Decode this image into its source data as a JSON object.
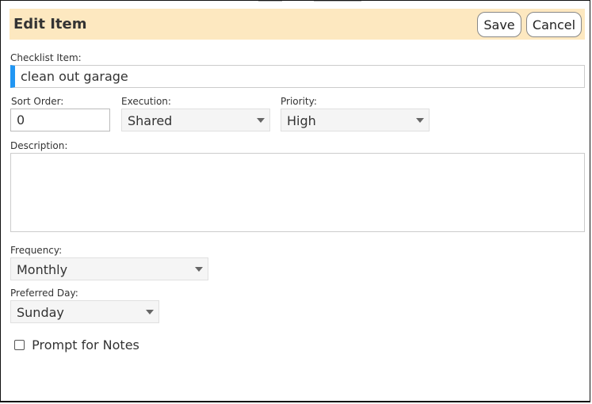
{
  "colors": {
    "header_bg": "#fde8c0",
    "accent": "#2196f3",
    "border": "#111111"
  },
  "header": {
    "title": "Edit Item",
    "save_label": "Save",
    "cancel_label": "Cancel"
  },
  "form": {
    "checklist_item": {
      "label": "Checklist Item:",
      "value": "clean out garage"
    },
    "sort_order": {
      "label": "Sort Order:",
      "value": "0"
    },
    "execution": {
      "label": "Execution:",
      "selected": "Shared",
      "icon": "chevron-down-icon"
    },
    "priority": {
      "label": "Priority:",
      "selected": "High",
      "icon": "chevron-down-icon"
    },
    "description": {
      "label": "Description:",
      "value": ""
    },
    "frequency": {
      "label": "Frequency:",
      "selected": "Monthly",
      "icon": "chevron-down-icon"
    },
    "preferred_day": {
      "label": "Preferred Day:",
      "selected": "Sunday",
      "icon": "chevron-down-icon"
    },
    "prompt_for_notes": {
      "label": "Prompt for Notes",
      "checked": false
    }
  }
}
